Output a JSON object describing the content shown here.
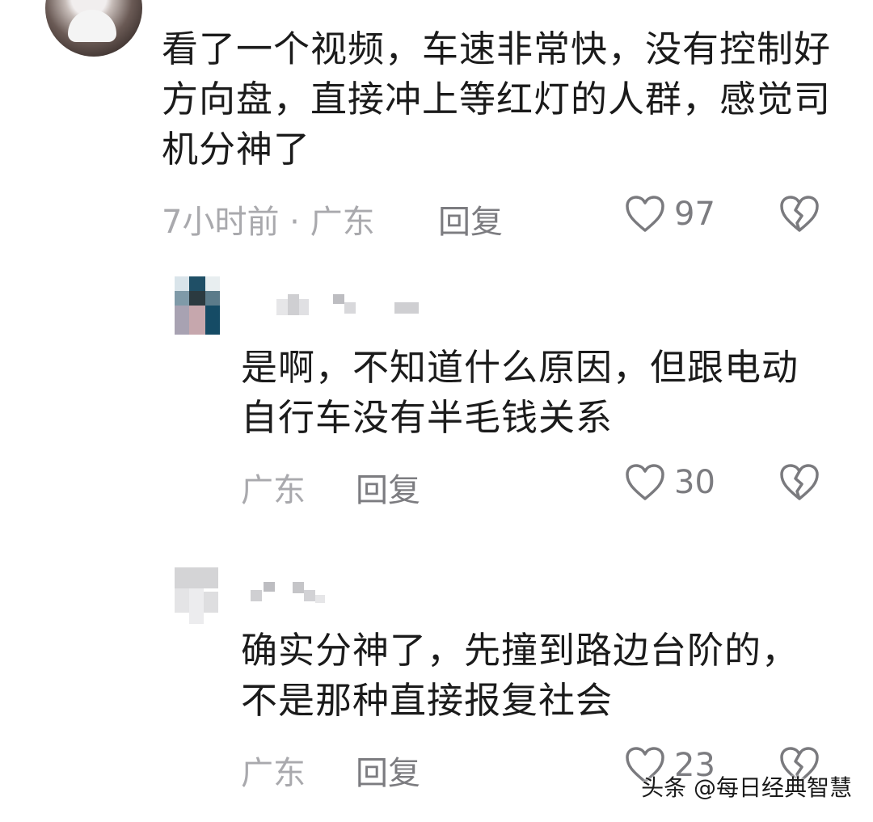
{
  "comments": [
    {
      "text": "看了一个视频，车速非常快，没有控制好方向盘，直接冲上等红灯的人群，感觉司机分神了",
      "meta": "7小时前 · 广东",
      "reply_label": "回复",
      "likes": "97",
      "icons": {
        "like": "heart-outline-icon",
        "dislike": "broken-heart-icon"
      },
      "replies": [
        {
          "text": "是啊，不知道什么原因，但跟电动自行车没有半毛钱关系",
          "meta": "广东",
          "reply_label": "回复",
          "likes": "30"
        },
        {
          "text": "确实分神了，先撞到路边台阶的，不是那种直接报复社会",
          "meta": "广东",
          "reply_label": "回复",
          "likes": "23"
        }
      ]
    }
  ],
  "watermark": "头条 @每日经典智慧",
  "colors": {
    "text": "#1b1b1b",
    "meta": "#a9a9ad",
    "action": "#7c7c80",
    "icon": "#7a7a7e"
  }
}
